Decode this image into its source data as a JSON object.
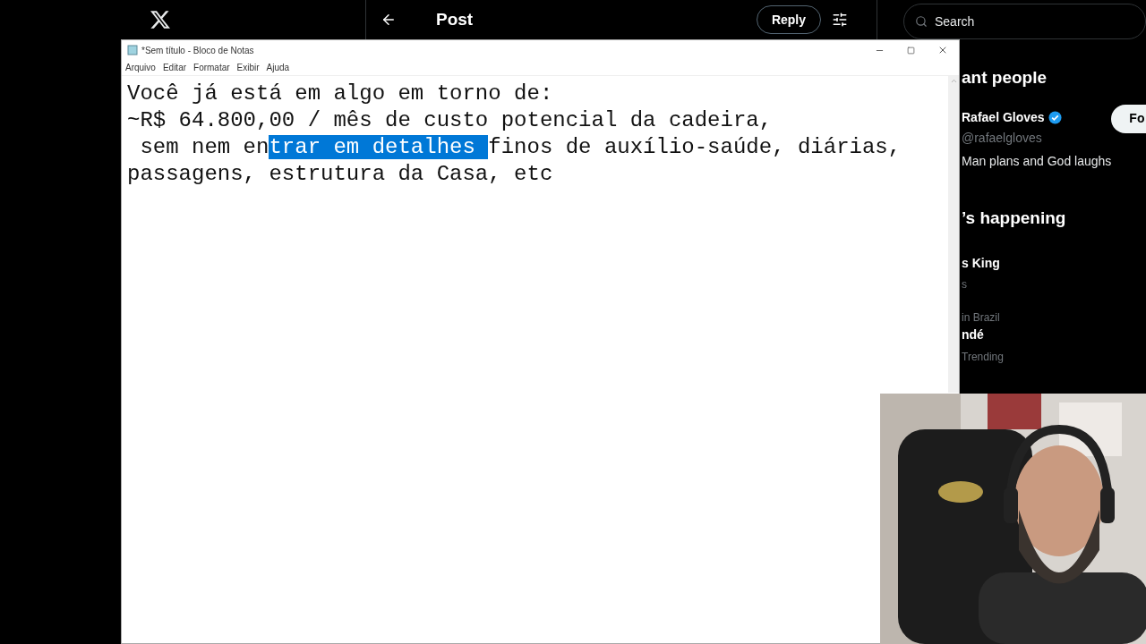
{
  "x_header": {
    "title": "Post",
    "reply_button": "Reply"
  },
  "search": {
    "placeholder": "Search"
  },
  "sidebar": {
    "relevant_heading": "ant people",
    "person": {
      "name": "Rafael Gloves",
      "verified": true,
      "handle": "@rafaelgloves",
      "bio": "Man plans and God laughs",
      "follow_button": "Fo"
    },
    "happening_heading": "’s happening",
    "trends": [
      {
        "title": "s King",
        "meta": "s"
      },
      {
        "context": "in Brazil",
        "title": "ndé"
      },
      {
        "context": "Trending"
      }
    ]
  },
  "notepad": {
    "title": "*Sem título - Bloco de Notas",
    "menu": [
      "Arquivo",
      "Editar",
      "Formatar",
      "Exibir",
      "Ajuda"
    ],
    "lines": [
      [
        {
          "text": "Você já está em algo em torno de:",
          "selected": false
        }
      ],
      [
        {
          "text": "~R$ 64.800,00 / mês de custo potencial da cadeira,",
          "selected": false
        }
      ],
      [
        {
          "text": " sem nem en",
          "selected": false
        },
        {
          "text": "trar em detalhes ",
          "selected": true
        },
        {
          "text": "finos de auxílio-saúde, diárias,",
          "selected": false
        }
      ],
      [
        {
          "text": "passagens, estrutura da Casa, etc",
          "selected": false
        }
      ]
    ]
  }
}
